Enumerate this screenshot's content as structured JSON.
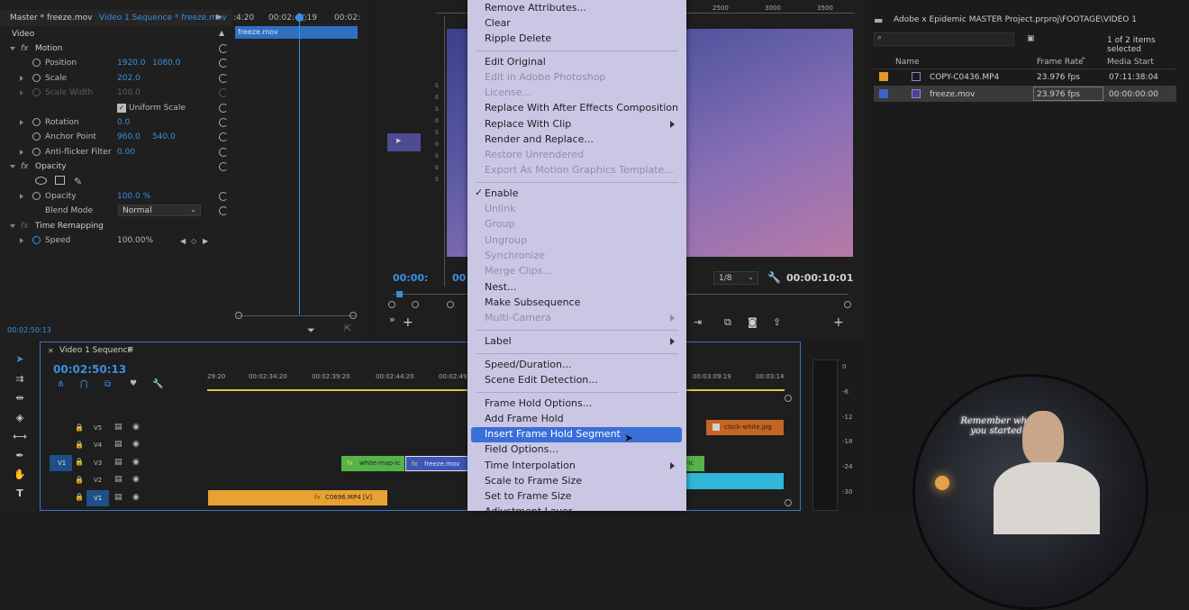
{
  "effect_controls": {
    "tab_master": "Master * freeze.mov",
    "tab_sequence": "Video 1 Sequence * freeze.mov",
    "section_video": "Video",
    "motion": "Motion",
    "position_label": "Position",
    "position_x": "1920.0",
    "position_y": "1080.0",
    "scale_label": "Scale",
    "scale_value": "202.0",
    "scale_width_label": "Scale Width",
    "scale_width_value": "100.0",
    "uniform_scale": "Uniform Scale",
    "rotation_label": "Rotation",
    "rotation_value": "0.0",
    "anchor_label": "Anchor Point",
    "anchor_x": "960.0",
    "anchor_y": "540.0",
    "antiflicker_label": "Anti-flicker Filter",
    "antiflicker_value": "0.00",
    "opacity_section": "Opacity",
    "opacity_label": "Opacity",
    "opacity_value": "100.0 %",
    "blend_label": "Blend Mode",
    "blend_value": "Normal",
    "time_remap": "Time Remapping",
    "speed_label": "Speed",
    "speed_value": "100.00%",
    "timecode": "00:02:50:13",
    "ruler_left": ":4:20",
    "ruler_mid": "00:02:4○19",
    "ruler_right": "00:02:",
    "clip_name": "freeze.mov"
  },
  "program_monitor": {
    "ruler_2500": "2500",
    "ruler_3000": "3000",
    "ruler_3500": "3500",
    "timecode_left": "00:00:",
    "timecode_left2": "00",
    "resolution": "1/8",
    "timecode_right": "00:00:10:01",
    "v_ticks": [
      "5",
      "0",
      "5",
      "0",
      "5",
      "0",
      "5",
      "0",
      "5"
    ]
  },
  "context_menu": {
    "items": [
      {
        "label": "Remove Attributes...",
        "disabled": false
      },
      {
        "label": "Clear",
        "disabled": false
      },
      {
        "label": "Ripple Delete",
        "disabled": false
      },
      {
        "label": "Edit Original",
        "disabled": false
      },
      {
        "label": "Edit in Adobe Photoshop",
        "disabled": true
      },
      {
        "label": "License...",
        "disabled": true
      },
      {
        "label": "Replace With After Effects Composition",
        "disabled": false
      },
      {
        "label": "Replace With Clip",
        "disabled": false
      },
      {
        "label": "Render and Replace...",
        "disabled": false
      },
      {
        "label": "Restore Unrendered",
        "disabled": true
      },
      {
        "label": "Export As Motion Graphics Template...",
        "disabled": true
      },
      {
        "label": "Enable",
        "disabled": false
      },
      {
        "label": "Unlink",
        "disabled": true
      },
      {
        "label": "Group",
        "disabled": true
      },
      {
        "label": "Ungroup",
        "disabled": true
      },
      {
        "label": "Synchronize",
        "disabled": true
      },
      {
        "label": "Merge Clips...",
        "disabled": true
      },
      {
        "label": "Nest...",
        "disabled": false
      },
      {
        "label": "Make Subsequence",
        "disabled": false
      },
      {
        "label": "Multi-Camera",
        "disabled": true
      },
      {
        "label": "Label",
        "disabled": false
      },
      {
        "label": "Speed/Duration...",
        "disabled": false
      },
      {
        "label": "Scene Edit Detection...",
        "disabled": false
      },
      {
        "label": "Frame Hold Options...",
        "disabled": false
      },
      {
        "label": "Add Frame Hold",
        "disabled": false
      },
      {
        "label": "Insert Frame Hold Segment",
        "disabled": false
      },
      {
        "label": "Field Options...",
        "disabled": false
      },
      {
        "label": "Time Interpolation",
        "disabled": false
      },
      {
        "label": "Scale to Frame Size",
        "disabled": false
      },
      {
        "label": "Set to Frame Size",
        "disabled": false
      },
      {
        "label": "Adjustment Layer",
        "disabled": false
      }
    ],
    "checked_item": "Enable",
    "highlighted_item": "Insert Frame Hold Segment"
  },
  "project": {
    "path": "Adobe x Epidemic MASTER Project.prproj\\FOOTAGE\\VIDEO 1",
    "count": "1 of 2 items selected",
    "col_name": "Name",
    "col_framerate": "Frame Rate",
    "col_mediastart": "Media Start",
    "rows": [
      {
        "name": "COPY-C0436.MP4",
        "framerate": "23.976 fps",
        "start": "07:11:38:04",
        "color": "#e8952e"
      },
      {
        "name": "freeze.mov",
        "framerate": "23.976 fps",
        "start": "00:00:00:00",
        "color": "#3b63c9"
      }
    ]
  },
  "timeline": {
    "tab_label": "Video 1 Sequence",
    "timecode": "00:02:50:13",
    "ruler": [
      "29:20",
      "00:02:34:20",
      "00:02:39:20",
      "00:02:44:20",
      "00:02:49",
      "00:03:09:19",
      "00:03:14"
    ],
    "tracks": [
      "V5",
      "V4",
      "V3",
      "V2",
      "V1"
    ],
    "source_v1": "V1",
    "clips": {
      "white_map_left": "white-map-ic",
      "freeze": "freeze.mov",
      "white_map_right": "-ic",
      "clock": "clock-white.jpg",
      "c0696": "C0696.MP4 [V]"
    }
  },
  "meter": {
    "ticks": [
      "0",
      "-6",
      "-12",
      "-18",
      "-24",
      "-30"
    ]
  },
  "webcam": {
    "neon_text": "Remember why you started"
  }
}
